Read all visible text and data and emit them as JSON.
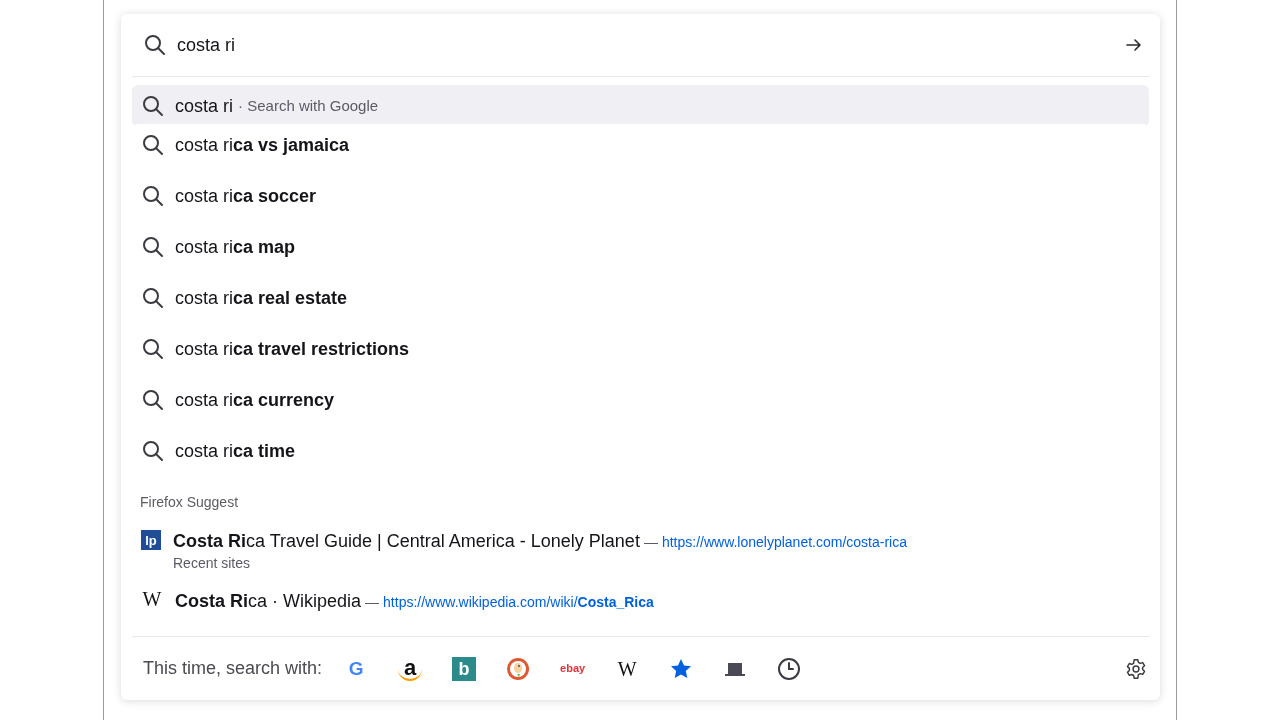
{
  "search": {
    "value": "costa ri"
  },
  "suggestions": [
    {
      "text": "costa ri",
      "hint": "· Search with Google",
      "selected": true
    },
    {
      "text": "costa ri**ca vs jamaica**",
      "selected": false
    },
    {
      "text": "costa ri**ca soccer**",
      "selected": false
    },
    {
      "text": "costa ri**ca map**",
      "selected": false
    },
    {
      "text": "costa ri**ca real estate**",
      "selected": false
    },
    {
      "text": "costa ri**ca travel restrictions**",
      "selected": false
    },
    {
      "text": "costa ri**ca currency**",
      "selected": false
    },
    {
      "text": "costa ri**ca time**",
      "selected": false
    }
  ],
  "firefox_suggest": {
    "heading": "Firefox Suggest",
    "items": [
      {
        "kind": "lp",
        "glyph": "lp",
        "title": "**Costa Ri**ca Travel Guide | Central America - Lonely Planet",
        "separator": "—",
        "url": "https://www.lonelyplanet.com/costa-rica",
        "subtitle": "Recent sites"
      },
      {
        "kind": "wikipedia",
        "glyph": "W",
        "title": "**Costa Ri**ca · Wikipedia",
        "separator": "—",
        "url": "https://www.wikipedia.com/wiki/**Costa_Rica**"
      }
    ]
  },
  "footer": {
    "label": "This time, search with:",
    "engines": [
      {
        "kind": "google",
        "glyph": "G"
      },
      {
        "kind": "amazon",
        "glyph": "a"
      },
      {
        "kind": "bing",
        "glyph": "b"
      },
      {
        "kind": "duckduckgo"
      },
      {
        "kind": "ebay",
        "glyph": "ebay"
      },
      {
        "kind": "wikipedia",
        "glyph": "W"
      },
      {
        "kind": "bookmarks"
      },
      {
        "kind": "tabs"
      },
      {
        "kind": "history"
      }
    ]
  }
}
